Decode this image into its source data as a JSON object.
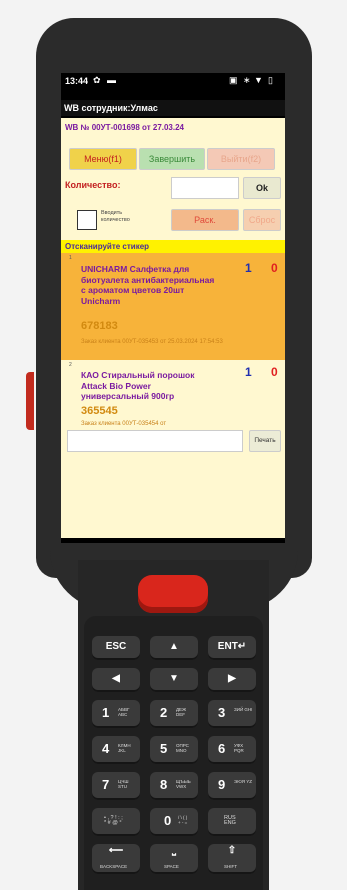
{
  "status": {
    "time": "13:44"
  },
  "app": {
    "title": "WB сотрудник:Улмас",
    "document": "WB № 00УТ-001698 от 27.03.24"
  },
  "buttons": {
    "menu": "Меню(f1)",
    "finish": "Завершить",
    "exit": "Выйти(f2)",
    "ok": "Ok",
    "rask": "Раск.",
    "reset": "Сброс",
    "print": "Печать"
  },
  "quantity": {
    "label": "Количество:",
    "value": "",
    "checkbox_label": "Вводить количество"
  },
  "scan_prompt": "Отсканируйте стикер",
  "items": [
    {
      "index": "1",
      "name": "UNICHARM Салфетка для биотуалета антибактериальная с ароматом цветов 20шт Unicharm",
      "code": "678183",
      "order": "Заказ клиента 00УТ-035453 от 25.03.2024 17:54:53",
      "count_a": "1",
      "count_b": "0"
    },
    {
      "index": "2",
      "name": "КАО Стиральный порошок Attack Bio Power универсальный 900гр",
      "code": "365545",
      "order": "Заказ клиента 00УТ-035454 от",
      "count_a": "1",
      "count_b": "0"
    }
  ],
  "keypad": {
    "esc": "ESC",
    "enter": "ENT↵",
    "up": "▲",
    "left": "◀",
    "down": "▼",
    "right": "▶",
    "k1": "1",
    "k1_sub": "АБВГ ABC",
    "k2": "2",
    "k2_sub": "ДЕЖ DEF",
    "k3": "3",
    "k3_sub": "ЗИЙ GHI",
    "k4": "4",
    "k4_sub": "КЛМН JKL",
    "k5": "5",
    "k5_sub": "ОПРС MNO",
    "k6": "6",
    "k6_sub": "УФХ PQR",
    "k7": "7",
    "k7_sub": "ЦЧШ STU",
    "k8": "8",
    "k8_sub": "ЩЪЫЬ VWX",
    "k9": "9",
    "k9_sub": "ЭЮЯ YZ",
    "sym": "• , ? ! : ;\n* # @ °",
    "k0": "0",
    "k0_sub": "/ \\ ( )\n+ - =",
    "lang": "RUS\nENG",
    "backspace": "BACKSPACE",
    "space": "SPACE",
    "shift": "SHIFT"
  },
  "colors": {
    "accent_purple": "#7a1aa0",
    "selected_row": "#f7b33a",
    "scan_bar": "#fff200",
    "scan_button": "#d9261c"
  }
}
